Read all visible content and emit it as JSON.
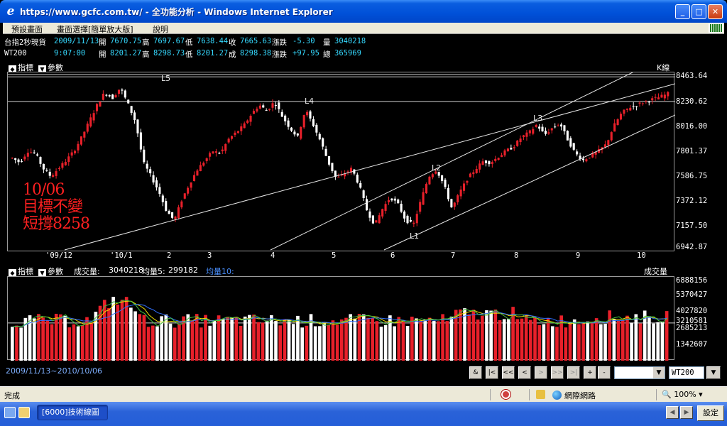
{
  "window": {
    "title": "https://www.gcfc.com.tw/ - 全功能分析 - Windows Internet Explorer"
  },
  "menu": {
    "items": [
      "預設畫面",
      "畫面選擇[簡單放大版]",
      "說明"
    ]
  },
  "quotes": [
    {
      "name": "台指2秒現貨",
      "date": "2009/11/13",
      "k1": "開",
      "v1": "7670.75",
      "k2": "高",
      "v2": "7697.67",
      "k3": "低",
      "v3": "7638.44",
      "k4": "收",
      "v4": "7665.63",
      "k5": "漲跌",
      "v5": "-5.30",
      "k6": "量",
      "v6": "3040218"
    },
    {
      "name": "WT200",
      "date": "9:07:00",
      "k1": "開",
      "v1": "8201.27",
      "k2": "高",
      "v2": "8298.73",
      "k3": "低",
      "v3": "8201.27",
      "k4": "成",
      "v4": "8298.38",
      "k5": "漲跌",
      "v5": "+97.95",
      "k6": "總",
      "v6": "365969"
    }
  ],
  "price_panel": {
    "indicator_label": "指標",
    "param_label": "參數",
    "chart_type_label": "K線",
    "y_ticks": [
      "8463.64",
      "8230.62",
      "8016.00",
      "7801.37",
      "7586.75",
      "7372.12",
      "7157.50",
      "6942.87"
    ],
    "x_ticks": [
      "'09/12",
      "'10/1",
      "2",
      "3",
      "4",
      "5",
      "6",
      "7",
      "8",
      "9",
      "10"
    ],
    "line_labels": [
      "L5",
      "L4",
      "L3",
      "L2",
      "L1"
    ],
    "annotation": [
      "10/06",
      "目標不變",
      "短撐8258"
    ]
  },
  "volume_panel": {
    "indicator_label": "指標",
    "param_label": "參數",
    "vol_label": "成交量:",
    "vol_value": "3040218",
    "ma5_label": "均量5:",
    "ma5_value": "299182",
    "ma10_label": "均量10:",
    "right_label": "成交量",
    "y_ticks": [
      "6888156",
      "5370427",
      "4027820",
      "3210581",
      "2685213",
      "1342607"
    ]
  },
  "toolbar": {
    "date_range": "2009/11/13~2010/10/06",
    "buttons": [
      "&",
      "|<",
      "<<",
      "<",
      ">",
      ">>",
      ">|",
      "+",
      "-"
    ],
    "symbol_value": "WT200"
  },
  "status": {
    "text": "完成",
    "zone": "網際網路",
    "zoom": "100%"
  },
  "taskbar": {
    "task_label": "[6000]技術線圖",
    "settings_label": "設定"
  },
  "colors": {
    "up": "#e8202a",
    "down": "#ffffff",
    "ma5": "#f0e000",
    "ma10": "#3070ff",
    "accent": "#35d9ff"
  },
  "chart_data": {
    "type": "candlestick",
    "title": "",
    "y_range": [
      6942.87,
      8463.64
    ],
    "x_categories": [
      "'09/12",
      "'10/1",
      "2",
      "3",
      "4",
      "5",
      "6",
      "7",
      "8",
      "9",
      "10"
    ],
    "close_path": [
      7740,
      7700,
      7800,
      7780,
      7650,
      7580,
      7650,
      7720,
      7800,
      7920,
      8060,
      8200,
      8310,
      8260,
      8350,
      8210,
      8050,
      7700,
      7580,
      7450,
      7280,
      7200,
      7380,
      7520,
      7640,
      7720,
      7800,
      7780,
      7900,
      7960,
      8020,
      8120,
      8200,
      8150,
      8230,
      8100,
      8000,
      7920,
      8160,
      8030,
      7880,
      7700,
      7560,
      7600,
      7650,
      7500,
      7280,
      7160,
      7300,
      7400,
      7340,
      7200,
      7160,
      7380,
      7580,
      7640,
      7500,
      7300,
      7440,
      7560,
      7640,
      7710,
      7700,
      7750,
      7800,
      7840,
      7920,
      7960,
      8030,
      7940,
      8000,
      8040,
      7900,
      7780,
      7720,
      7760,
      7800,
      7860,
      8020,
      8130,
      8180,
      8200,
      8230,
      8250,
      8270,
      8298
    ],
    "volume_y_ticks": [
      6888156,
      5370427,
      4027820,
      3210581,
      2685213,
      1342607
    ],
    "volume_last": 3040218,
    "volume_ma5": 299182
  }
}
